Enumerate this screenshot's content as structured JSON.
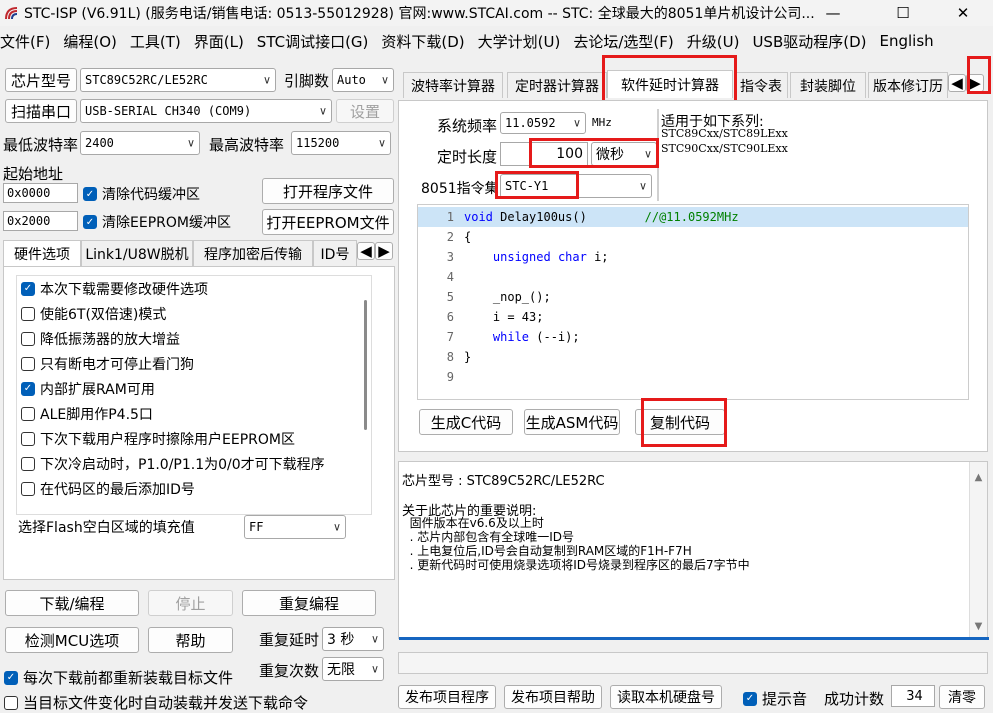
{
  "window": {
    "title": "STC-ISP (V6.91L) (服务电话/销售电话: 0513-55012928) 官网:www.STCAI.com  -- STC: 全球最大的8051单片机设计公司...",
    "minimize": "—",
    "maximize": "☐",
    "close": "✕"
  },
  "menu": [
    "文件(F)",
    "编程(O)",
    "工具(T)",
    "界面(L)",
    "STC调试接口(G)",
    "资料下载(D)",
    "大学计划(U)",
    "去论坛/选型(F)",
    "升级(U)",
    "USB驱动程序(D)",
    "English"
  ],
  "left": {
    "chip_model_btn": "芯片型号",
    "chip_model_value": "STC89C52RC/LE52RC",
    "pin_count_label": "引脚数",
    "pin_count_value": "Auto",
    "scan_port_btn": "扫描串口",
    "port_value": "USB-SERIAL CH340 (COM9)",
    "settings_btn": "设置",
    "min_baud_label": "最低波特率",
    "min_baud_value": "2400",
    "max_baud_label": "最高波特率",
    "max_baud_value": "115200",
    "start_addr_label": "起始地址",
    "addr1": "0x0000",
    "clear_code_label": "清除代码缓冲区",
    "open_program_btn": "打开程序文件",
    "addr2": "0x2000",
    "clear_eeprom_label": "清除EEPROM缓冲区",
    "open_eeprom_btn": "打开EEPROM文件",
    "tabs": [
      "硬件选项",
      "Link1/U8W脱机",
      "程序加密后传输",
      "ID号"
    ],
    "options": [
      {
        "label": "本次下载需要修改硬件选项",
        "checked": true
      },
      {
        "label": "使能6T(双倍速)模式",
        "checked": false
      },
      {
        "label": "降低振荡器的放大增益",
        "checked": false
      },
      {
        "label": "只有断电才可停止看门狗",
        "checked": false
      },
      {
        "label": "内部扩展RAM可用",
        "checked": true
      },
      {
        "label": "ALE脚用作P4.5口",
        "checked": false
      },
      {
        "label": "下次下载用户程序时擦除用户EEPROM区",
        "checked": false
      },
      {
        "label": "下次冷启动时，P1.0/P1.1为0/0才可下载程序",
        "checked": false
      },
      {
        "label": "在代码区的最后添加ID号",
        "checked": false
      }
    ],
    "flash_fill_label": "选择Flash空白区域的填充值",
    "flash_fill_value": "FF",
    "download_btn": "下载/编程",
    "stop_btn": "停止",
    "reprogram_btn": "重复编程",
    "detect_btn": "检测MCU选项",
    "help_btn": "帮助",
    "repeat_delay_label": "重复延时",
    "repeat_delay_value": "3 秒",
    "repeat_count_label": "重复次数",
    "repeat_count_value": "无限",
    "reload_label": "每次下载前都重新装载目标文件",
    "reload_checked": true,
    "auto_label": "当目标文件变化时自动装载并发送下载命令",
    "auto_checked": false
  },
  "right": {
    "tabs": [
      "波特率计算器",
      "定时器计算器",
      "软件延时计算器",
      "指令表",
      "封装脚位",
      "版本修订历"
    ],
    "sys_freq_label": "系统频率",
    "sys_freq_value": "11.0592",
    "sys_freq_unit": "MHz",
    "series_title": "适用于如下系列:",
    "series_1": "STC89Cxx/STC89LExx",
    "series_2": "STC90Cxx/STC90LExx",
    "delay_len_label": "定时长度",
    "delay_len_value": "100",
    "delay_unit": "微秒",
    "isa_label": "8051指令集",
    "isa_value": "STC-Y1",
    "code_lines": [
      {
        "n": "1",
        "text": "void Delay100us()\t\t//@11.0592MHz"
      },
      {
        "n": "2",
        "text": "{"
      },
      {
        "n": "3",
        "text": "\tunsigned char i;"
      },
      {
        "n": "4",
        "text": ""
      },
      {
        "n": "5",
        "text": "\t_nop_();"
      },
      {
        "n": "6",
        "text": "\ti = 43;"
      },
      {
        "n": "7",
        "text": "\twhile (--i);"
      },
      {
        "n": "8",
        "text": "}"
      },
      {
        "n": "9",
        "text": ""
      }
    ],
    "gen_c_btn": "生成C代码",
    "gen_asm_btn": "生成ASM代码",
    "copy_btn": "复制代码",
    "info": {
      "chip_line": "芯片型号 : STC89C52RC/LE52RC",
      "note_title": "关于此芯片的重要说明:",
      "lines": [
        "  固件版本在v6.6及以上时",
        "  . 芯片内部包含有全球唯一ID号",
        "  . 上电复位后,ID号会自动复制到RAM区域的F1H-F7H",
        "  . 更新代码时可使用烧录选项将ID号烧录到程序区的最后7字节中"
      ]
    },
    "publish_btn": "发布项目程序",
    "publish_help_btn": "发布项目帮助",
    "read_disk_btn": "读取本机硬盘号",
    "tone_label": "提示音",
    "tone_checked": true,
    "success_label": "成功计数",
    "success_value": "34",
    "clear_btn": "清零"
  },
  "colors": {
    "accent": "#005fb8",
    "highlight": "#e51a1a",
    "code_line_bg": "#cce4f7"
  }
}
